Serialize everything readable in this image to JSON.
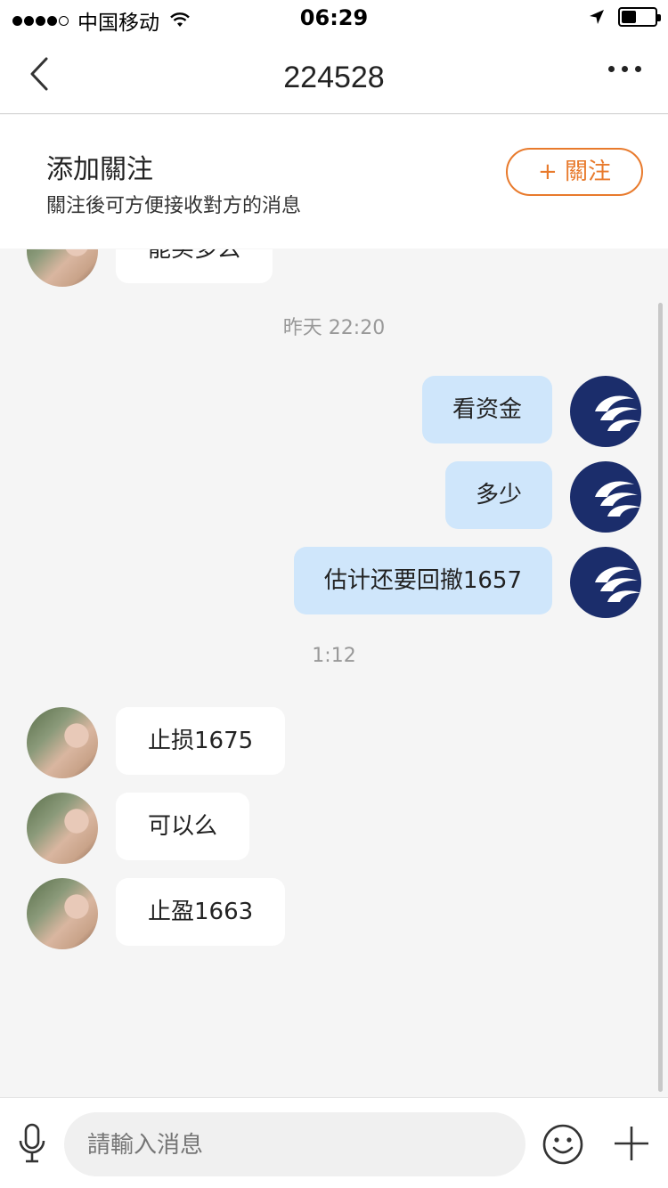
{
  "status_bar": {
    "carrier": "中国移动",
    "time": "06:29",
    "battery_level": 0.45
  },
  "nav": {
    "title": "224528"
  },
  "follow_banner": {
    "title": "添加關注",
    "description": "關注後可方便接收對方的消息",
    "button_label": "+ 關注"
  },
  "messages": {
    "partial_top": "能买多么",
    "time_1": "昨天 22:20",
    "sent": [
      {
        "text": "看资金"
      },
      {
        "text": "多少"
      },
      {
        "text": "估计还要回撤1657"
      }
    ],
    "time_2": "1:12",
    "received": [
      {
        "text": "止损1675"
      },
      {
        "text": "可以么"
      },
      {
        "text": "止盈1663"
      }
    ]
  },
  "input_bar": {
    "placeholder": "請輸入消息"
  },
  "icons": {
    "back": "chevron-left-icon",
    "more": "more-horizontal-icon",
    "mic": "microphone-icon",
    "emoji": "smiley-icon",
    "plus": "plus-icon"
  },
  "colors": {
    "accent": "#e87a2c",
    "sent_bubble": "#cfe6fb",
    "received_bubble": "#ffffff",
    "avatar_right": "#1b2d6b"
  }
}
